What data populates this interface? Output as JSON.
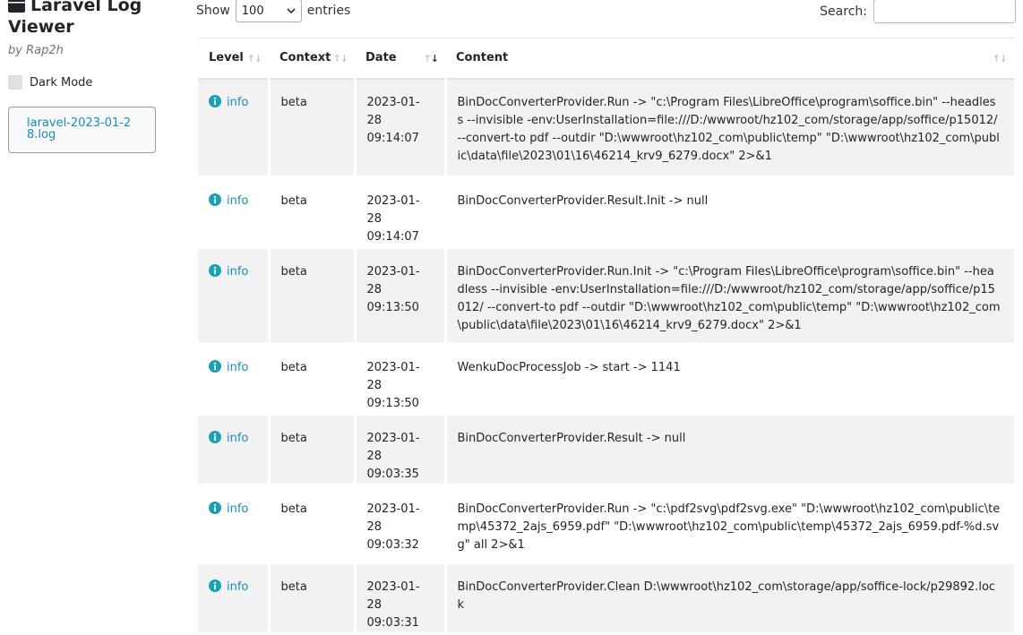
{
  "sidebar": {
    "title": "Laravel Log Viewer",
    "subtitle": "by Rap2h",
    "dark_mode_label": "Dark Mode",
    "file_name": "laravel-2023-01-28.log"
  },
  "controls": {
    "show_label": "Show",
    "length_value": "100",
    "entries_label": "entries",
    "search_label": "Search:",
    "search_value": ""
  },
  "table": {
    "headers": {
      "level": "Level",
      "context": "Context",
      "date": "Date",
      "content": "Content"
    },
    "rows": [
      {
        "level": "info",
        "context": "beta",
        "date": "2023-01-28 09:14:07",
        "content": "BinDocConverterProvider.Run -> \"c:\\Program Files\\LibreOffice\\program\\soffice.bin\" --headless --invisible -env:UserInstallation=file:///D:/wwwroot/hz102_com/storage/app/soffice/p15012/ --convert-to pdf --outdir \"D:\\wwwroot\\hz102_com\\public\\temp\" \"D:\\wwwroot\\hz102_com\\public\\data\\file\\2023\\01\\16\\46214_krv9_6279.docx\" 2>&1"
      },
      {
        "level": "info",
        "context": "beta",
        "date": "2023-01-28 09:14:07",
        "content": "BinDocConverterProvider.Result.Init -> null"
      },
      {
        "level": "info",
        "context": "beta",
        "date": "2023-01-28 09:13:50",
        "content": "BinDocConverterProvider.Run.Init -> \"c:\\Program Files\\LibreOffice\\program\\soffice.bin\" --headless --invisible -env:UserInstallation=file:///D:/wwwroot/hz102_com/storage/app/soffice/p15012/ --convert-to pdf --outdir \"D:\\wwwroot\\hz102_com\\public\\temp\" \"D:\\wwwroot\\hz102_com\\public\\data\\file\\2023\\01\\16\\46214_krv9_6279.docx\" 2>&1"
      },
      {
        "level": "info",
        "context": "beta",
        "date": "2023-01-28 09:13:50",
        "content": "WenkuDocProcessJob -> start -> 1141"
      },
      {
        "level": "info",
        "context": "beta",
        "date": "2023-01-28 09:03:35",
        "content": "BinDocConverterProvider.Result -> null"
      },
      {
        "level": "info",
        "context": "beta",
        "date": "2023-01-28 09:03:32",
        "content": "BinDocConverterProvider.Run -> \"c:\\pdf2svg\\pdf2svg.exe\" \"D:\\wwwroot\\hz102_com\\public\\temp\\45372_2ajs_6959.pdf\" \"D:\\wwwroot\\hz102_com\\public\\temp\\45372_2ajs_6959.pdf-%d.svg\" all 2>&1"
      },
      {
        "level": "info",
        "context": "beta",
        "date": "2023-01-28 09:03:31",
        "content": "BinDocConverterProvider.Clean D:\\wwwroot\\hz102_com\\storage/app/soffice-lock/p29892.lock"
      }
    ]
  },
  "colors": {
    "info": "#17a2b8",
    "link": "#1a8bb8",
    "stripe": "#f2f2f2"
  },
  "icons": {
    "title": "calendar-icon",
    "level": "info-circle-icon",
    "select": "chevron-down-icon",
    "sort": "sort-arrows-icon"
  }
}
